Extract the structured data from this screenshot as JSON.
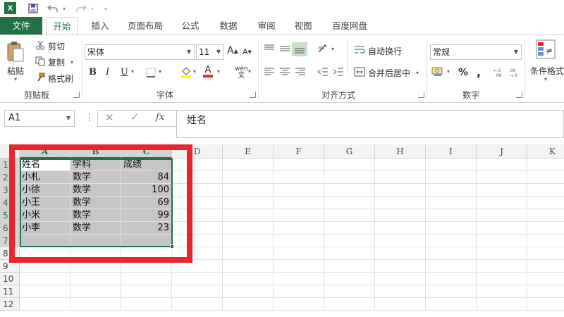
{
  "app": {
    "logo_letter": "X"
  },
  "tabs": [
    "文件",
    "开始",
    "插入",
    "页面布局",
    "公式",
    "数据",
    "审阅",
    "视图",
    "百度网盘"
  ],
  "ribbon": {
    "clipboard": {
      "paste": "粘贴",
      "cut": "剪切",
      "copy": "复制",
      "format_painter": "格式刷",
      "label": "剪贴板"
    },
    "font": {
      "font_name": "宋体",
      "font_size": "11",
      "grow": "A",
      "shrink": "A",
      "bold": "B",
      "italic": "I",
      "underline": "U",
      "font_color_letter": "A",
      "phonetic": "wén",
      "label": "字体"
    },
    "alignment": {
      "wrap_text": "自动换行",
      "merge_center": "合并后居中",
      "label": "对齐方式"
    },
    "number": {
      "format": "常规",
      "percent": "%",
      "comma": ",",
      "label": "数字"
    },
    "styles": {
      "conditional": "条件格式"
    }
  },
  "formula_bar": {
    "name_box": "A1",
    "content": "姓名",
    "fx": "fx"
  },
  "grid": {
    "columns": [
      "A",
      "B",
      "C",
      "D",
      "E",
      "F",
      "G",
      "H",
      "I",
      "J",
      "K"
    ],
    "rows": [
      "1",
      "2",
      "3",
      "4",
      "5",
      "6",
      "7",
      "8",
      "9",
      "10",
      "11",
      "12"
    ],
    "header_row": [
      "姓名",
      "学科",
      "成绩"
    ],
    "data": [
      [
        "小札",
        "数学",
        "84"
      ],
      [
        "小徐",
        "数学",
        "100"
      ],
      [
        "小王",
        "数学",
        "69"
      ],
      [
        "小米",
        "数学",
        "99"
      ],
      [
        "小李",
        "数学",
        "23"
      ]
    ]
  },
  "colors": {
    "excel_green": "#217346",
    "annotation_red": "#e8252d",
    "selection_gray": "#c6c6c6"
  }
}
